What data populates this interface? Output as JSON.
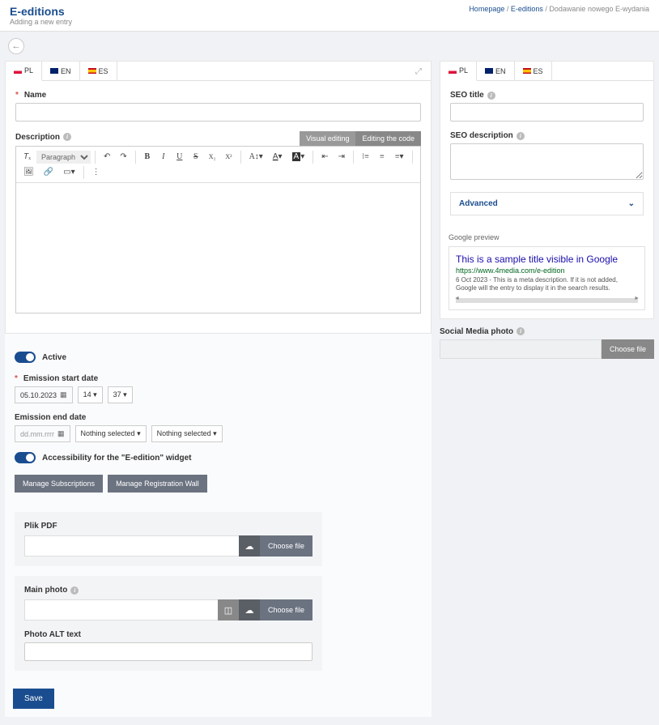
{
  "header": {
    "title": "E-editions",
    "subtitle": "Adding a new entry",
    "breadcrumb": {
      "home": "Homepage",
      "section": "E-editions",
      "current": "Dodawanie nowego E-wydania"
    }
  },
  "tabs": {
    "pl": "PL",
    "en": "EN",
    "es": "ES"
  },
  "main": {
    "name_label": "Name",
    "desc_label": "Description",
    "visual_editing": "Visual editing",
    "editing_code": "Editing the code",
    "paragraph": "Paragraph",
    "active_label": "Active",
    "emission_start_label": "Emission start date",
    "start_date": "05.10.2023",
    "start_hour": "14",
    "start_min": "37",
    "emission_end_label": "Emission end date",
    "end_date_placeholder": "dd.mm.rrrr",
    "nothing_selected": "Nothing selected",
    "accessibility_label": "Accessibility for the \"E-edition\" widget",
    "manage_subs": "Manage Subscriptions",
    "manage_reg": "Manage Registration Wall",
    "plik_pdf": "Plik PDF",
    "choose_file": "Choose file",
    "main_photo": "Main photo",
    "photo_alt": "Photo ALT text",
    "save": "Save"
  },
  "seo": {
    "title_label": "SEO title",
    "desc_label": "SEO description",
    "advanced": "Advanced",
    "google_preview": "Google preview",
    "gp_title": "This is a sample title visible in Google",
    "gp_url": "https://www.4media.com/e-edition",
    "gp_desc": "6 Oct 2023 - This is a meta description. If it is not added, Google will the entry to display it in the search results.",
    "social_label": "Social Media photo",
    "choose_file": "Choose file"
  }
}
